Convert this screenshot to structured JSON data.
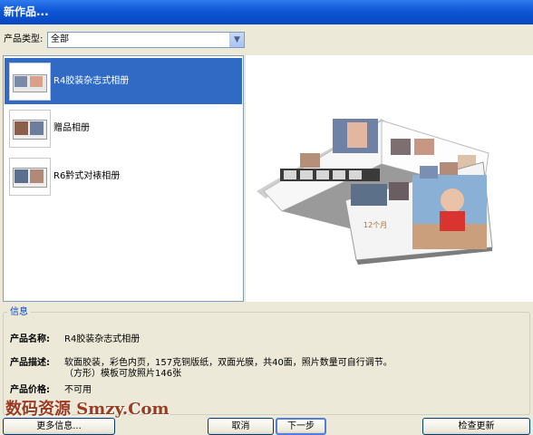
{
  "window": {
    "title": "新作品..."
  },
  "filter": {
    "label": "产品类型:",
    "value": "全部"
  },
  "products": [
    {
      "label": "R4胶装杂志式相册",
      "selected": true
    },
    {
      "label": "赠品相册",
      "selected": false
    },
    {
      "label": "R6黔式对裱相册",
      "selected": false
    }
  ],
  "preview": {
    "age_caption": "12个月"
  },
  "info": {
    "legend": "信息",
    "name_label": "产品名称:",
    "name_value": "R4胶装杂志式相册",
    "desc_label": "产品描述:",
    "desc_line1": "软面胶装，彩色内页，157克铜版纸，双面光膜，共40面，照片数量可自行调节。",
    "desc_line2": "（方形）模板可放照片146张",
    "price_label": "产品价格:",
    "price_value": "不可用"
  },
  "watermark": "数码资源 Smzy.Com",
  "buttons": {
    "more_info": "更多信息...",
    "cancel": "取消",
    "next": "下一步",
    "check_update": "检查更新"
  }
}
